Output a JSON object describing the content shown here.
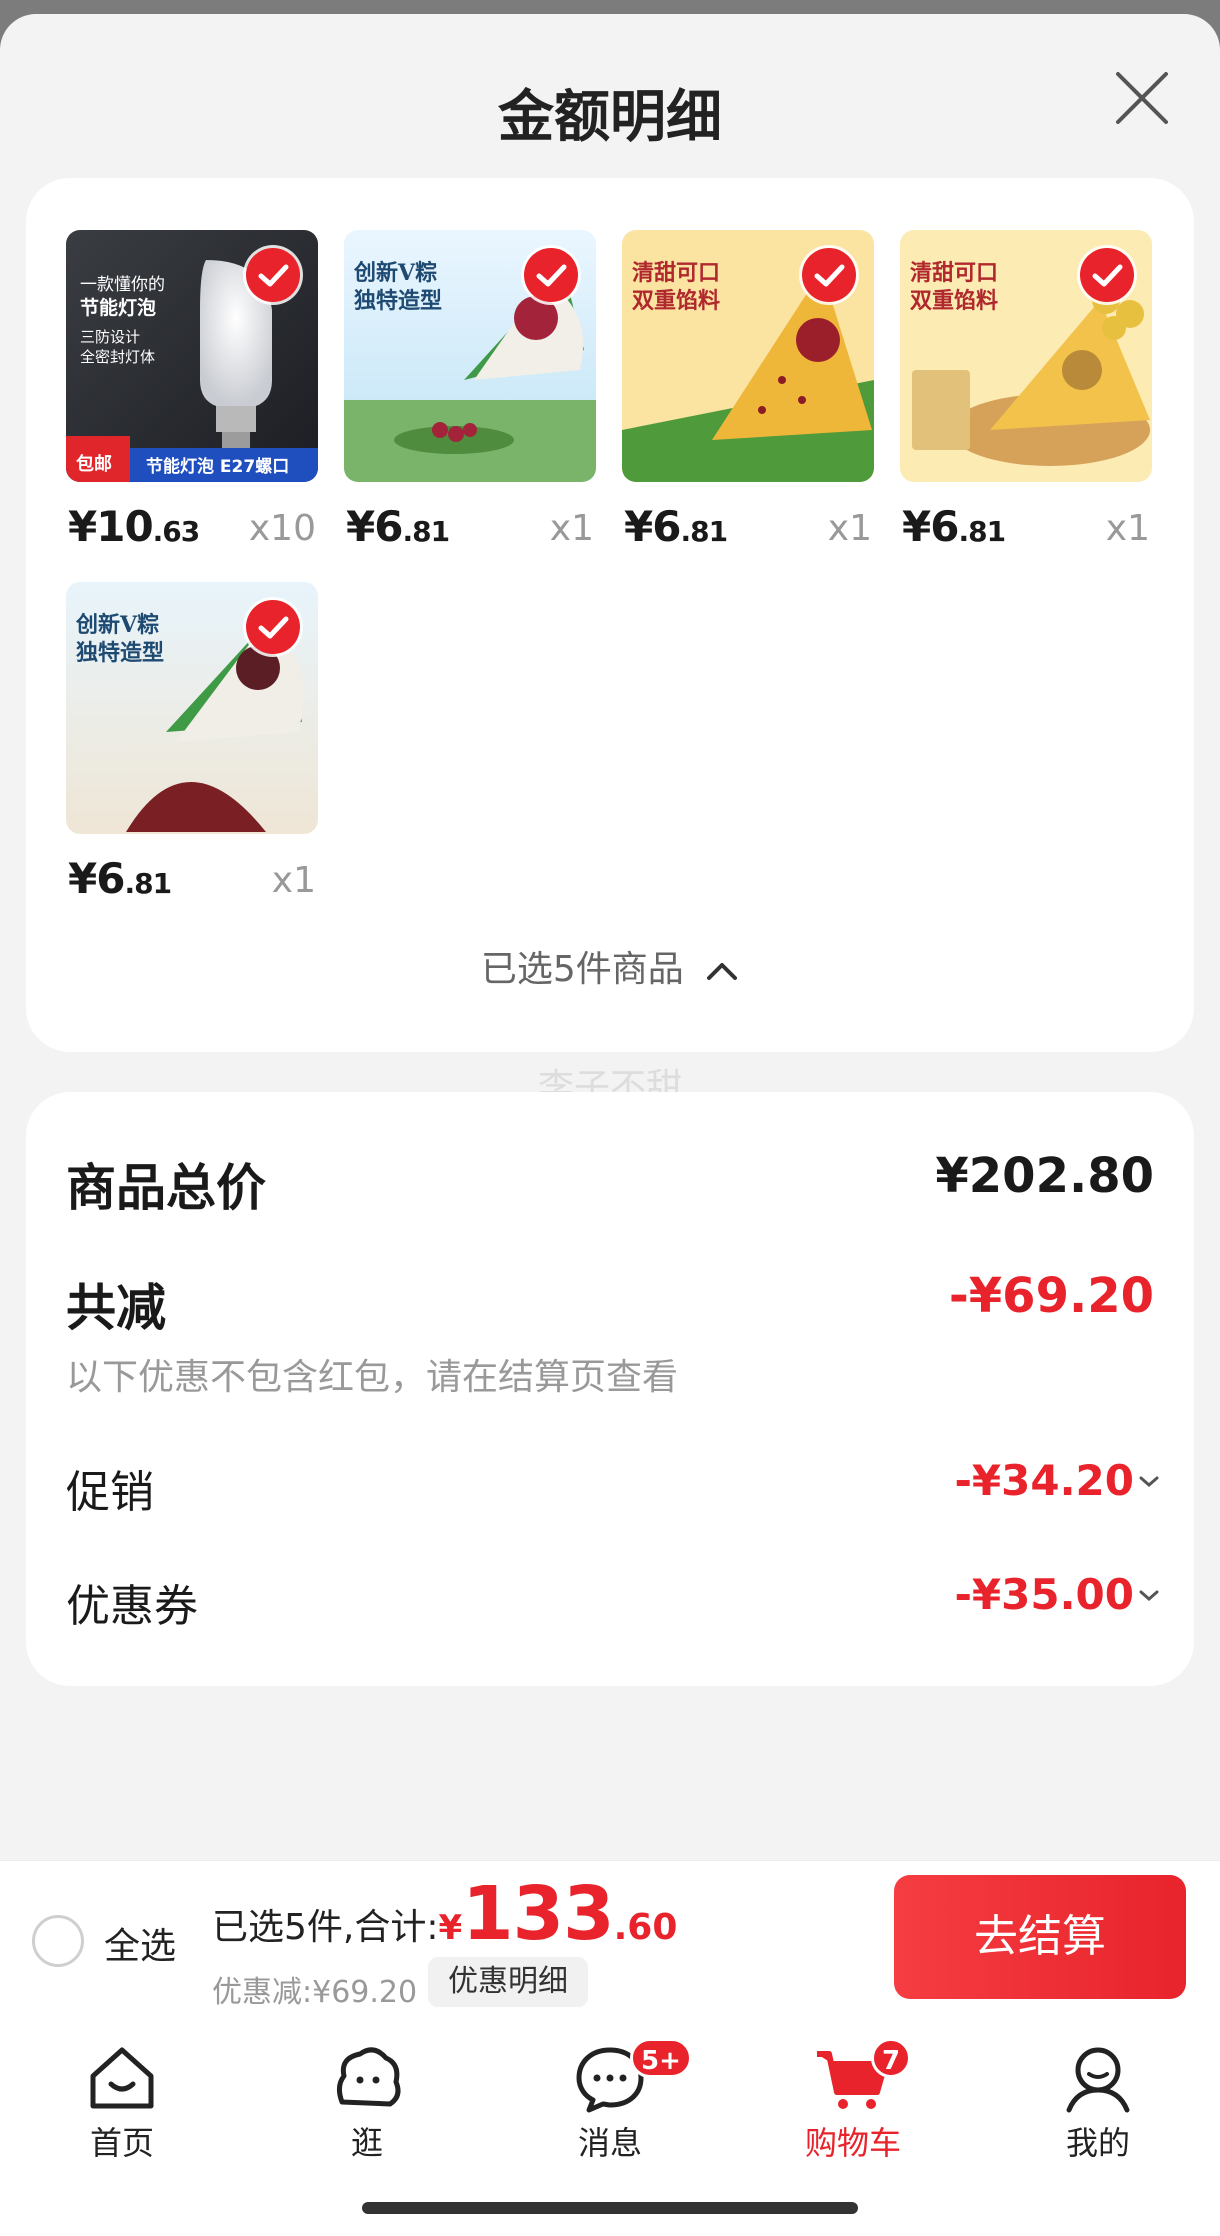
{
  "sheet": {
    "title": "金额明细"
  },
  "products": [
    {
      "price_int": "¥10",
      "price_dec": ".63",
      "qty": "x10",
      "art": "bulb",
      "art_text": [
        "一款懂你的",
        "节能灯泡",
        "三防设计",
        "全密封灯体"
      ],
      "tag": "包邮",
      "caption": "节能灯泡 E27螺口"
    },
    {
      "price_int": "¥6",
      "price_dec": ".81",
      "qty": "x1",
      "art": "zongzi-white",
      "art_text": [
        "创新V粽",
        "独特造型"
      ]
    },
    {
      "price_int": "¥6",
      "price_dec": ".81",
      "qty": "x1",
      "art": "zongzi-yellow",
      "art_text": [
        "清甜可口",
        "双重馅料"
      ]
    },
    {
      "price_int": "¥6",
      "price_dec": ".81",
      "qty": "x1",
      "art": "zongzi-yolk",
      "art_text": [
        "清甜可口",
        "双重馅料"
      ]
    },
    {
      "price_int": "¥6",
      "price_dec": ".81",
      "qty": "x1",
      "art": "zongzi-bean",
      "art_text": [
        "创新V粽",
        "独特造型"
      ]
    }
  ],
  "selected_summary": "已选5件商品",
  "watermark": "李子不甜",
  "summary": {
    "total_label": "商品总价",
    "total_value": "¥202.80",
    "reduce_label": "共减",
    "reduce_value": "-¥69.20",
    "note": "以下优惠不包含红包，请在结算页查看",
    "promo_label": "促销",
    "promo_value": "-¥34.20",
    "coupon_label": "优惠券",
    "coupon_value": "-¥35.00"
  },
  "footer": {
    "select_all": "全选",
    "selected_prefix": "已选5件,合计:",
    "currency": "¥",
    "total_int": "133",
    "total_dec": ".60",
    "discount": "优惠减:¥69.20",
    "detail_button": "优惠明细",
    "checkout": "去结算"
  },
  "tabs": [
    {
      "label": "首页",
      "icon": "home-icon"
    },
    {
      "label": "逛",
      "icon": "browse-icon"
    },
    {
      "label": "消息",
      "icon": "message-icon",
      "badge": "5+"
    },
    {
      "label": "购物车",
      "icon": "cart-icon",
      "badge": "7",
      "active": true
    },
    {
      "label": "我的",
      "icon": "profile-icon"
    }
  ],
  "colors": {
    "accent": "#e9232b",
    "background": "#f3f3f3"
  }
}
